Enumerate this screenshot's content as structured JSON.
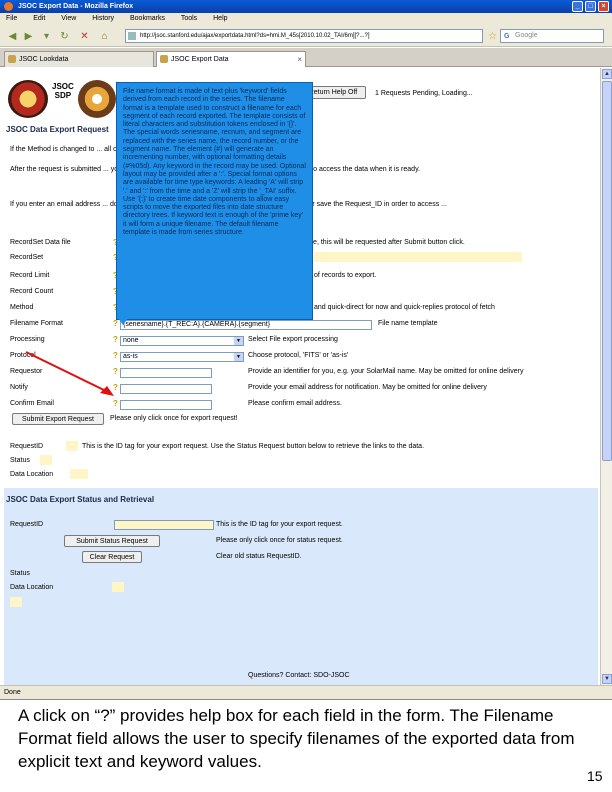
{
  "window": {
    "title": "JSOC Export Data - Mozilla Firefox"
  },
  "menu": [
    "File",
    "Edit",
    "View",
    "History",
    "Bookmarks",
    "Tools",
    "Help"
  ],
  "nav": {
    "url": "http://jsoc.stanford.edu/ajax/exportdata.html?ds=hmi.M_45s[2010.10.02_TAI/6m][?...?]",
    "search_placeholder": "Google"
  },
  "tabs": [
    {
      "label": "JSOC Lookdata"
    },
    {
      "label": "JSOC Export Data"
    }
  ],
  "page": {
    "logo_text": "JSOC\nSDP",
    "help_button": "Return Help Off",
    "status_text": "1 Requests Pending, Loading...",
    "section1_title": "JSOC Data Export Request",
    "para1": "If the Method is changed to ... all options to specify \"url-direct\" is temporarily disabled.",
    "para2": "After the request is submitted ... you will receive ON THIS PAGE a \"Request ID\" that will be used to access the data when it is ready.",
    "para3": "If you enter an email address ... do not provide an email address you must leave this page open or save the Request_ID in order to access ...",
    "fields": [
      {
        "label": "RecordSet Data file",
        "desc": "file, this will be requested after Submit button click."
      },
      {
        "label": "RecordSet",
        "desc": ""
      },
      {
        "label": "Record Limit",
        "desc": "of records to export."
      },
      {
        "label": "Record Count",
        "desc": ""
      },
      {
        "label": "Method",
        "desc": "and quick-direct for now and quick-replies protocol of fetch"
      },
      {
        "label": "Filename Format",
        "value": "{seriesname}.{T_REC:A}.{CAMERA}.{segment}",
        "desc": "File name template"
      },
      {
        "label": "Processing",
        "value": "none",
        "desc": "Select File export processing"
      },
      {
        "label": "Protocol",
        "value": "as-is",
        "desc": "Choose protocol, 'FITS' or 'as-is'"
      },
      {
        "label": "Requestor",
        "desc": "Provide an identifier for you, e.g. your SolarMail name. May be omitted for online delivery"
      },
      {
        "label": "Notify",
        "desc": "Provide your email address for notification. May be omitted for online delivery"
      },
      {
        "label": "Confirm Email",
        "desc": "Please confirm email address."
      }
    ],
    "submit_button": "Submit Export Request",
    "submit_note": "Please only click once for export request!",
    "request_id_label": "RequestID",
    "request_id_desc": "This is the ID tag for your export request. Use the Status Request button below to retrieve the links to the data.",
    "status_label": "Status",
    "data_location_label": "Data Location",
    "section2_title": "JSOC Data Export Status and Retrieval",
    "s2_request_id_label": "RequestID",
    "s2_request_id_desc": "This is the ID tag for your export request.",
    "status_request_button": "Submit Status Request",
    "status_request_note": "Please only click once for status request.",
    "clear_request_button": "Clear Request",
    "clear_request_note": "Clear old status RequestID.",
    "s2_status_label": "Status",
    "s2_data_location_label": "Data Location",
    "footer": "Questions? Contact: SDO-JSOC",
    "popup_text": "File name format is made of text plus 'keyword' fields derived from each record in the series. The filename format is a template used to construct a filename for each segment of each record exported. The template consists of literal characters and substitution tokens enclosed in '{}'. The special words seriesname, recnum, and segment are replaced with the series name, the record number, or the segment name. The element {#} will generate an incrementing number, with optional formatting details (#%05d). Any keyword in the record may be used. Optional layout may be provided after a ':'. Special format options are available for time type keywords: A leading 'A' will strip '.' and ':' from the time and a 'Z' will strip the '_TAI' suffix. Use '{:}' to create time date components to allow easy scripts to move the exported files into date structure directory trees. If keyword text is enough of the 'prime key' it will form a unique filename. The default filename template is made from series structure."
  },
  "browser_status": "Done",
  "caption": "A click on “?” provides help box for each field in the form.  The Filename Format field allows the user to specify filenames of the exported data from explicit text and keyword values.",
  "page_number": "15"
}
